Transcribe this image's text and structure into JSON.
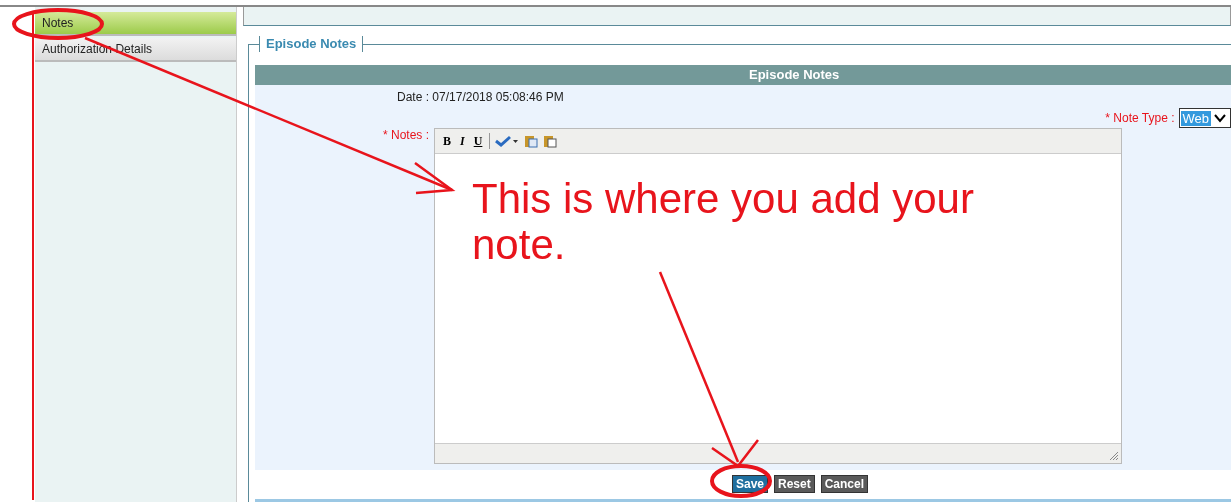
{
  "sidebar": {
    "items": [
      {
        "label": "Notes",
        "selected": true
      },
      {
        "label": "Authorization Details",
        "selected": false
      }
    ]
  },
  "section": {
    "legend": "Episode Notes",
    "header": "Episode Notes",
    "date": "Date : 07/17/2018 05:08:46 PM",
    "note_type": {
      "label": "* Note Type :",
      "value": "Web"
    },
    "notes": {
      "label": "* Notes :",
      "toolbar": [
        "B",
        "I",
        "U"
      ]
    },
    "buttons": [
      {
        "label": "Save",
        "kind": "primary"
      },
      {
        "label": "Reset",
        "kind": "secondary"
      },
      {
        "label": "Cancel",
        "kind": "secondary"
      }
    ]
  },
  "annotation": {
    "text": "This is where you add your note."
  }
}
